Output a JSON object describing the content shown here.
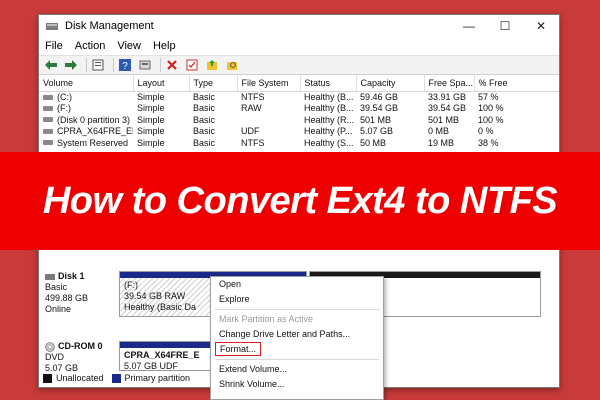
{
  "window": {
    "title": "Disk Management",
    "controls": {
      "minimize": "—",
      "maximize": "☐",
      "close": "✕"
    }
  },
  "menu": [
    "File",
    "Action",
    "View",
    "Help"
  ],
  "toolbar_icons": [
    "back-arrow-icon",
    "forward-arrow-icon",
    "properties-icon",
    "help-icon",
    "rescan-icon",
    "delete-icon",
    "check-icon",
    "open-folder-icon",
    "explore-icon"
  ],
  "volume_table": {
    "columns": [
      "Volume",
      "Layout",
      "Type",
      "File System",
      "Status",
      "Capacity",
      "Free Spa...",
      "% Free"
    ],
    "rows": [
      [
        "(C:)",
        "Simple",
        "Basic",
        "NTFS",
        "Healthy (B...",
        "59.46 GB",
        "33.91 GB",
        "57 %"
      ],
      [
        "(F:)",
        "Simple",
        "Basic",
        "RAW",
        "Healthy (B...",
        "39.54 GB",
        "39.54 GB",
        "100 %"
      ],
      [
        "(Disk 0 partition 3)",
        "Simple",
        "Basic",
        "",
        "Healthy (R...",
        "501 MB",
        "501 MB",
        "100 %"
      ],
      [
        "CPRA_X64FRE_EN-...",
        "Simple",
        "Basic",
        "UDF",
        "Healthy (P...",
        "5.07 GB",
        "0 MB",
        "0 %"
      ],
      [
        "System Reserved",
        "Simple",
        "Basic",
        "NTFS",
        "Healthy (S...",
        "50 MB",
        "19 MB",
        "38 %"
      ]
    ]
  },
  "banner": {
    "text": "How to Convert Ext4 to NTFS"
  },
  "disks": {
    "disk1": {
      "name": "Disk 1",
      "type": "Basic",
      "size": "499.88 GB",
      "status": "Online"
    },
    "cdrom0": {
      "name": "CD-ROM 0",
      "type": "DVD",
      "size": "5.07 GB"
    }
  },
  "partitions": {
    "f": {
      "label": "(F:)",
      "detail": "39.54 GB RAW",
      "status": "Healthy (Basic Da"
    },
    "cd": {
      "label": "CPRA_X64FRE_E",
      "detail": "5.07 GB UDF"
    }
  },
  "legend": {
    "unallocated": "Unallocated",
    "primary": "Primary partition"
  },
  "context_menu": {
    "open": "Open",
    "explore": "Explore",
    "mark_active": "Mark Partition as Active",
    "change_letter": "Change Drive Letter and Paths...",
    "format": "Format...",
    "extend": "Extend Volume...",
    "shrink": "Shrink Volume..."
  },
  "colors": {
    "banner": "#ee0000",
    "primary_partition": "#1a2a8a",
    "highlight": "#e02020"
  }
}
